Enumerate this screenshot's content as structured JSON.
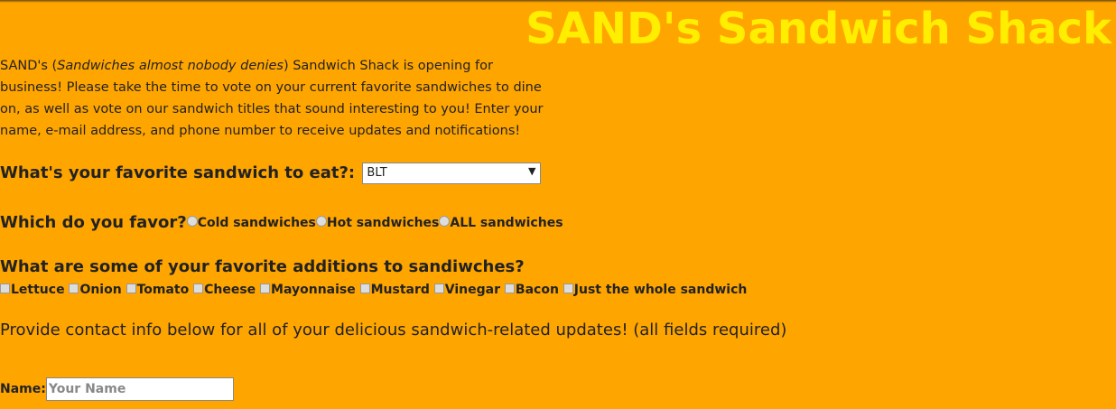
{
  "header": {
    "title": "SAND's Sandwich Shack"
  },
  "intro": {
    "prefix": "SAND's (",
    "acronym_meaning": "Sandwiches almost nobody denies",
    "rest": ") Sandwich Shack is opening for business! Please take the time to vote on your current favorite sandwiches to dine on, as well as vote on our sandwich titles that sound interesting to you! Enter your name, e-mail address, and phone number to receive updates and notifications!"
  },
  "favorite_sandwich": {
    "question": "What's your favorite sandwich to eat?:",
    "selected": "BLT"
  },
  "favor": {
    "question": "Which do you favor?",
    "options": [
      "Cold sandwiches",
      "Hot sandwiches",
      "ALL sandwiches"
    ]
  },
  "additions": {
    "question": "What are some of your favorite additions to sandiwches?",
    "options": [
      "Lettuce",
      "Onion",
      "Tomato",
      "Cheese",
      "Mayonnaise",
      "Mustard",
      "Vinegar",
      "Bacon",
      "Just the whole sandwich"
    ]
  },
  "contact": {
    "text": "Provide contact info below for all of your delicious sandwich-related updates! (all fields required)",
    "name_label": "Name:",
    "name_placeholder": "Your Name"
  }
}
